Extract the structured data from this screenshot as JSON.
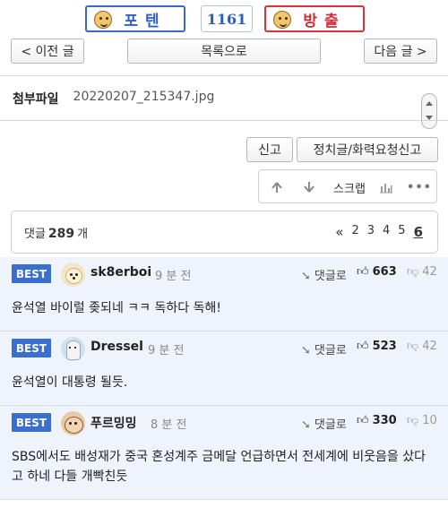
{
  "vote": {
    "up_label": "포텐",
    "count": "1161",
    "down_label": "방출"
  },
  "nav": {
    "prev": "< 이전 글",
    "list": "목록으로",
    "next": "다음 글 >"
  },
  "attachment": {
    "label": "첨부파일",
    "file": "20220207_215347.jpg"
  },
  "actions": {
    "report": "신고",
    "report_politics": "정치글/화력요청신고"
  },
  "toolbar": {
    "scrap": "스크랩",
    "more": "•••"
  },
  "comment_summary": {
    "prefix": "댓글",
    "count": "289",
    "suffix": "개"
  },
  "pager": {
    "prev": "«",
    "pages": [
      "2",
      "3",
      "4",
      "5"
    ],
    "current": "6"
  },
  "comments": [
    {
      "badge": "BEST",
      "nick": "sk8erboi",
      "time": "9 분 전",
      "reply": "댓글로",
      "likes": "663",
      "dislikes": "42",
      "text": "윤석열 바이럴 좆되네 ㅋㅋ 독하다 독해!"
    },
    {
      "badge": "BEST",
      "nick": "Dressel",
      "time": "9 분 전",
      "reply": "댓글로",
      "likes": "523",
      "dislikes": "42",
      "text": "윤석열이 대통령 될듯."
    },
    {
      "badge": "BEST",
      "nick": "푸르밍밍",
      "time": "8 분 전",
      "reply": "댓글로",
      "likes": "330",
      "dislikes": "10",
      "text": "SBS에서도 배성재가 중국 혼성계주 금메달 언급하면서 전세계에 비웃음을 샀다고 하네 다들 개빡친듯"
    }
  ],
  "colors": {
    "up_blue": "#2f5fc8",
    "down_red": "#d42c36",
    "best_badge": "#3a6fd0",
    "comment_bg": "#eff3fb"
  }
}
